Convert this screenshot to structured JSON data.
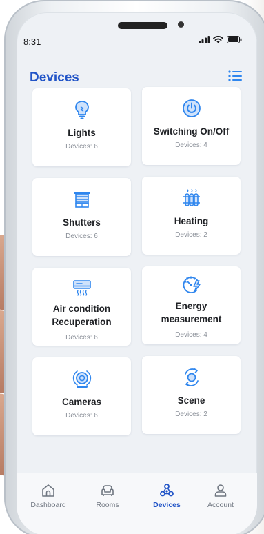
{
  "status_bar": {
    "time": "8:31"
  },
  "header": {
    "title": "Devices"
  },
  "devices": [
    {
      "title": "Lights",
      "subtitle": "Devices: 6"
    },
    {
      "title": "Switching On/Off",
      "subtitle": "Devices: 4"
    },
    {
      "title": "Shutters",
      "subtitle": "Devices: 6"
    },
    {
      "title": "Heating",
      "subtitle": "Devices: 2"
    },
    {
      "title_line1": "Air condition",
      "title_line2": "Recuperation",
      "subtitle": "Devices: 6"
    },
    {
      "title_line1": "Energy",
      "title_line2": "measurement",
      "subtitle": "Devices: 4"
    },
    {
      "title": "Cameras",
      "subtitle": "Devices: 6"
    },
    {
      "title": "Scene",
      "subtitle": "Devices: 2"
    }
  ],
  "nav": [
    {
      "label": "Dashboard",
      "icon": "home-icon"
    },
    {
      "label": "Rooms",
      "icon": "sofa-icon"
    },
    {
      "label": "Devices",
      "icon": "devices-icon",
      "active": true
    },
    {
      "label": "Account",
      "icon": "user-icon"
    }
  ],
  "colors": {
    "accent": "#2154c7",
    "icon_blue": "#2f86ee",
    "background": "#eef1f5"
  }
}
